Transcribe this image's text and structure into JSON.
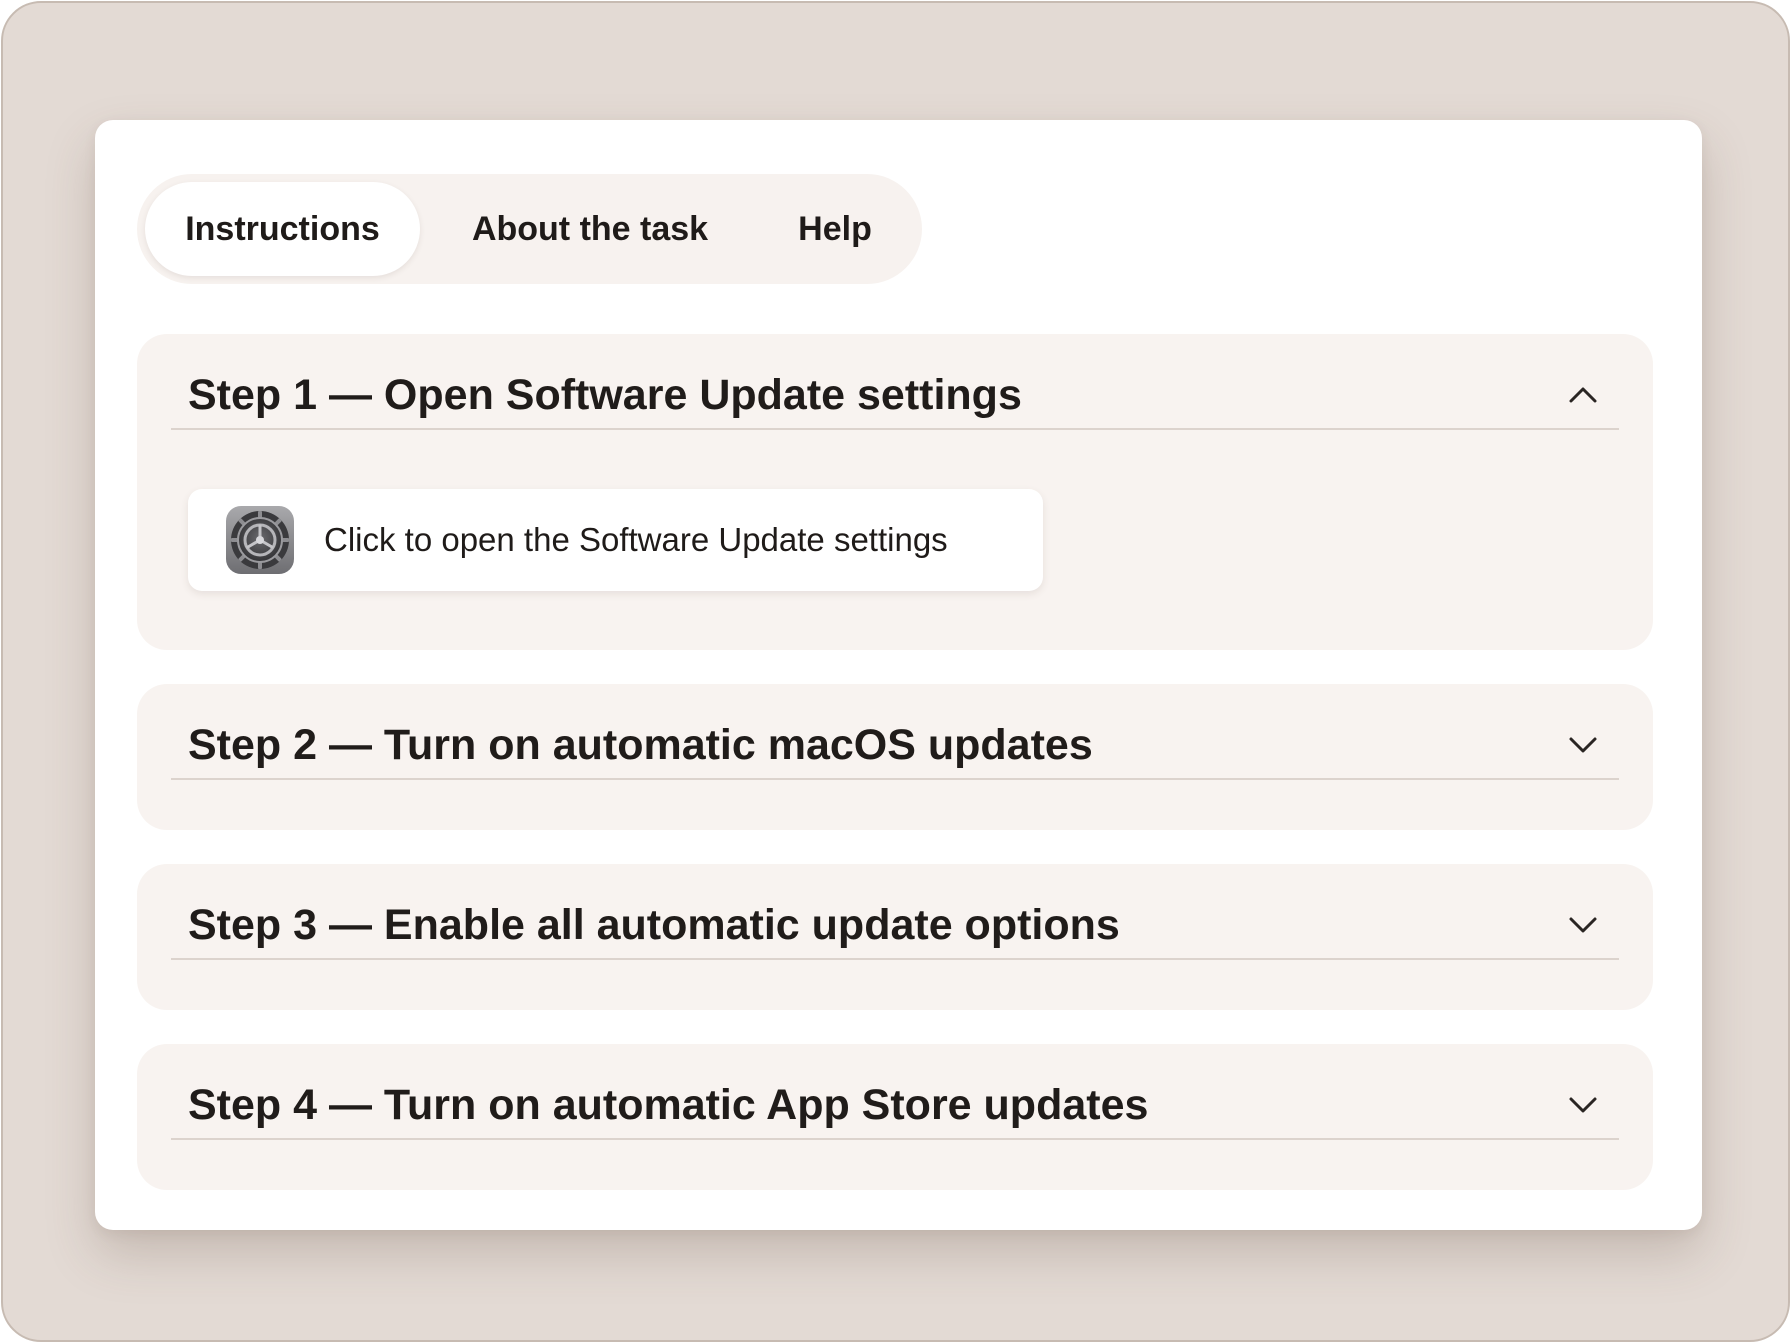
{
  "tabs": [
    {
      "label": "Instructions",
      "active": true
    },
    {
      "label": "About the task",
      "active": false
    },
    {
      "label": "Help",
      "active": false
    }
  ],
  "steps": [
    {
      "title": "Step 1 — Open Software Update settings",
      "expanded": true,
      "action": {
        "label": "Click to open the Software Update settings",
        "icon": "system-settings-gear-icon"
      }
    },
    {
      "title": "Step 2 — Turn on automatic macOS updates",
      "expanded": false
    },
    {
      "title": "Step 3 — Enable all automatic update options",
      "expanded": false
    },
    {
      "title": "Step 4 — Turn on automatic App Store updates",
      "expanded": false
    }
  ],
  "colors": {
    "background": "#e3dad4",
    "card": "#ffffff",
    "panel": "#f8f3f0",
    "text": "#1f1b19"
  }
}
